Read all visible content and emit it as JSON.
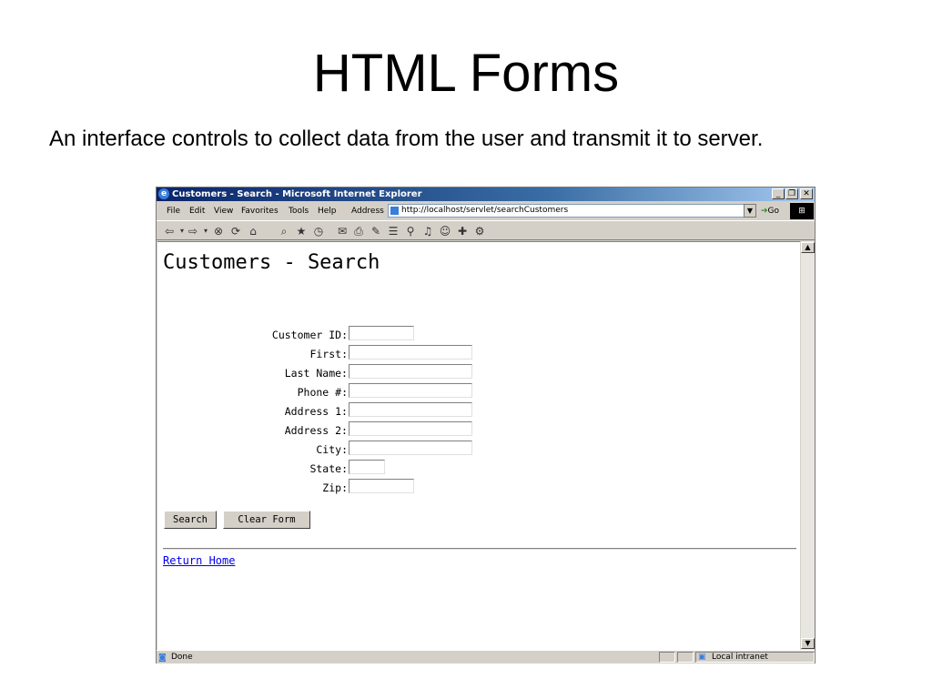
{
  "slide": {
    "title": "HTML Forms",
    "body": "An interface controls to collect data from the user and transmit it to server."
  },
  "browser": {
    "window_title": "Customers - Search - Microsoft Internet Explorer",
    "menu": [
      "File",
      "Edit",
      "View",
      "Favorites",
      "Tools",
      "Help"
    ],
    "address_label": "Address",
    "url": "http://localhost/servlet/searchCustomers",
    "go_label": "Go",
    "status_left": "Done",
    "status_zone": "Local intranet"
  },
  "page": {
    "heading": "Customers - Search",
    "fields": [
      {
        "label": "Customer ID:",
        "value": ""
      },
      {
        "label": "First:",
        "value": ""
      },
      {
        "label": "Last Name:",
        "value": ""
      },
      {
        "label": "Phone #:",
        "value": ""
      },
      {
        "label": "Address 1:",
        "value": ""
      },
      {
        "label": "Address 2:",
        "value": ""
      },
      {
        "label": "City:",
        "value": ""
      },
      {
        "label": "State:",
        "value": ""
      },
      {
        "label": "Zip:",
        "value": ""
      }
    ],
    "search_button": "Search",
    "clear_button": "Clear Form",
    "return_link": "Return Home"
  },
  "colors": {
    "titlebar_start": "#0a246a",
    "chrome": "#d4d0c8",
    "link": "#0000ee"
  }
}
